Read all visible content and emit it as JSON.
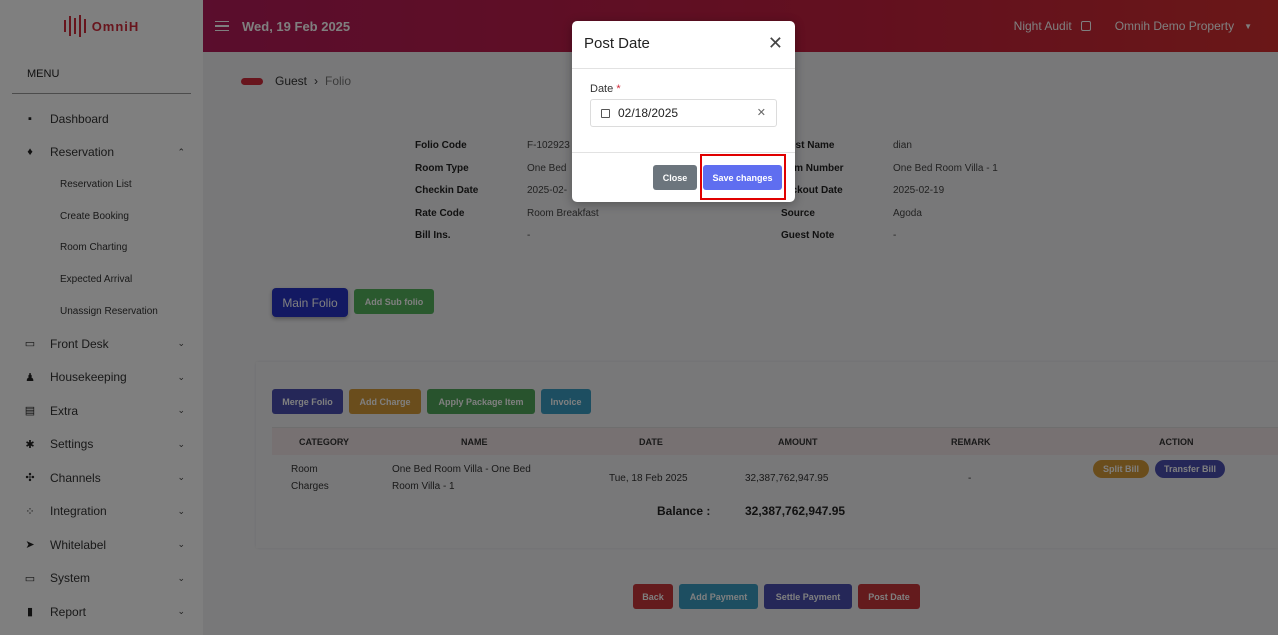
{
  "brand": {
    "logo_text": "OmniH"
  },
  "sidebar": {
    "menu_title": "MENU",
    "items": [
      {
        "label": "Dashboard",
        "icon": "dashboard-icon",
        "glyph": "▪",
        "chevron": ""
      },
      {
        "label": "Reservation",
        "icon": "bell-icon",
        "glyph": "♦",
        "chevron": "⌃"
      },
      {
        "label": "Front Desk",
        "icon": "window-icon",
        "glyph": "▭",
        "chevron": "⌄"
      },
      {
        "label": "Housekeeping",
        "icon": "person-broom-icon",
        "glyph": "♟",
        "chevron": "⌄"
      },
      {
        "label": "Extra",
        "icon": "list-icon",
        "glyph": "▤",
        "chevron": "⌄"
      },
      {
        "label": "Settings",
        "icon": "gear-icon",
        "glyph": "✱",
        "chevron": "⌄"
      },
      {
        "label": "Channels",
        "icon": "network-icon",
        "glyph": "✣",
        "chevron": "⌄"
      },
      {
        "label": "Integration",
        "icon": "grid-icon",
        "glyph": "⁘",
        "chevron": "⌄"
      },
      {
        "label": "Whitelabel",
        "icon": "tag-icon",
        "glyph": "➤",
        "chevron": "⌄"
      },
      {
        "label": "System",
        "icon": "laptop-icon",
        "glyph": "▭",
        "chevron": "⌄"
      },
      {
        "label": "Report",
        "icon": "document-icon",
        "glyph": "▮",
        "chevron": "⌄"
      }
    ],
    "reservation_sub": [
      "Reservation List",
      "Create Booking",
      "Room Charting",
      "Expected Arrival",
      "Unassign Reservation"
    ]
  },
  "header": {
    "date": "Wed, 19 Feb 2025",
    "night_audit": "Night Audit",
    "property": "Omnih Demo Property"
  },
  "breadcrumb": {
    "guest": "Guest",
    "sep": "›",
    "folio": "Folio"
  },
  "folio_info": {
    "folio_code_label": "Folio Code",
    "folio_code": "F-102923",
    "room_type_label": "Room Type",
    "room_type": "One Bed",
    "checkin_label": "Checkin Date",
    "checkin": "2025-02-",
    "rate_code_label": "Rate Code",
    "rate_code": "Room Breakfast",
    "bill_ins_label": "Bill Ins.",
    "bill_ins": "-",
    "guest_name_label": "est Name",
    "guest_name": "dian",
    "room_number_label": "om Number",
    "room_number": "One Bed Room Villa - 1",
    "checkout_label": "eckout Date",
    "checkout": "2025-02-19",
    "source_label": "Source",
    "source": "Agoda",
    "guest_note_label": "Guest Note",
    "guest_note": "-"
  },
  "folio_tabs": {
    "main": "Main Folio",
    "add_sub": "Add Sub folio"
  },
  "actions": {
    "merge": "Merge Folio",
    "add_charge": "Add Charge",
    "apply_package": "Apply Package Item",
    "invoice": "Invoice"
  },
  "table": {
    "headers": [
      "CATEGORY",
      "NAME",
      "DATE",
      "AMOUNT",
      "REMARK",
      "ACTION"
    ],
    "rows": [
      {
        "category_1": "Room",
        "category_2": "Charges",
        "name_1": "One Bed Room Villa - One Bed",
        "name_2": "Room Villa - 1",
        "date": "Tue, 18 Feb 2025",
        "amount": "32,387,762,947.95",
        "remark": "-",
        "split": "Split Bill",
        "transfer": "Transfer Bill"
      }
    ],
    "balance_label": "Balance :",
    "balance_value": "32,387,762,947.95"
  },
  "footer_buttons": {
    "back": "Back",
    "add_payment": "Add Payment",
    "settle_payment": "Settle Payment",
    "post_date": "Post Date"
  },
  "modal": {
    "title": "Post Date",
    "close_glyph": "✕",
    "date_label": "Date",
    "required_mark": "*",
    "date_value": "02/18/2025",
    "clear_glyph": "✕",
    "close_button": "Close",
    "save_button": "Save changes"
  },
  "colors": {
    "accent": "#d12a3a",
    "primary": "#5f6ef0",
    "highlight": "#e00000"
  }
}
